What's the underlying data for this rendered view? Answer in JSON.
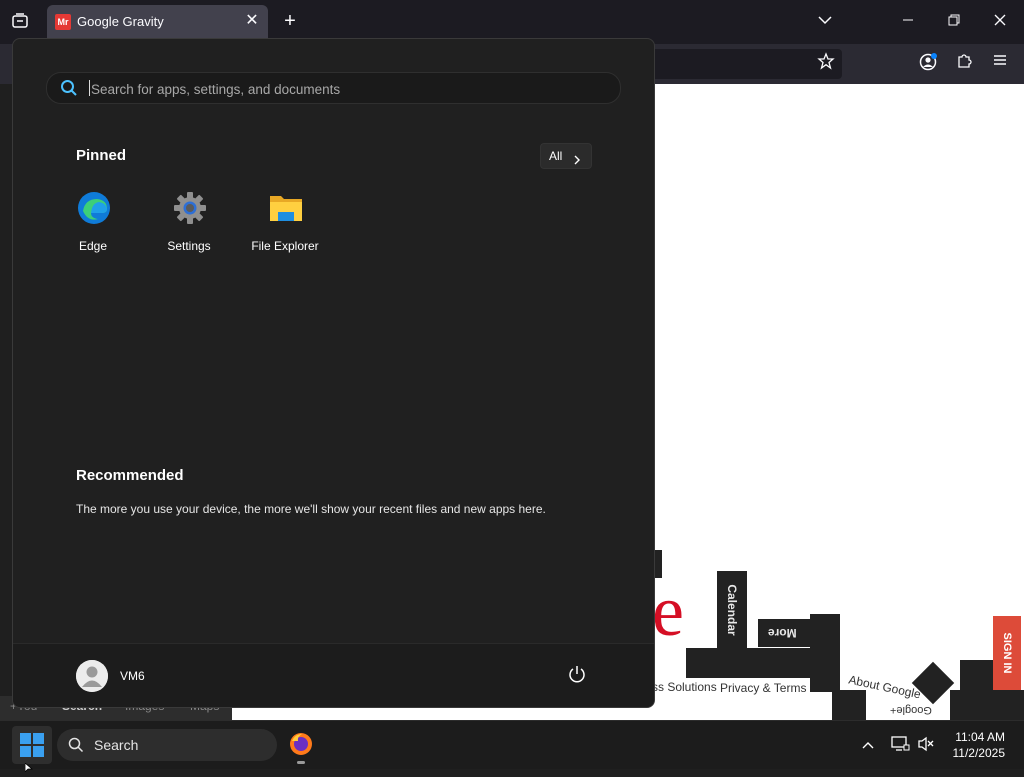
{
  "browser": {
    "tab_title": "Google Gravity",
    "tab_favicon_text": "Mr"
  },
  "page": {
    "calendar": "Calendar",
    "more": "More",
    "business": "ss Solutions",
    "privacy": "Privacy & Terms",
    "about": "About Google",
    "google_plus": "Google+",
    "sign_in": "SIGN IN",
    "logo_fragment": "e",
    "bottom_links": [
      "+You",
      "Search",
      "Images",
      "Maps"
    ]
  },
  "start_menu": {
    "search_placeholder": "Search for apps, settings, and documents",
    "pinned_title": "Pinned",
    "all_label": "All",
    "apps": [
      {
        "label": "Edge",
        "icon": "edge-icon"
      },
      {
        "label": "Settings",
        "icon": "settings-gear-icon"
      },
      {
        "label": "File Explorer",
        "icon": "folder-icon"
      }
    ],
    "recommended_title": "Recommended",
    "recommended_text": "The more you use your device, the more we'll show your recent files and new apps here.",
    "user_name": "VM6"
  },
  "taskbar": {
    "search_label": "Search",
    "time": "11:04 AM",
    "date": "11/2/2025"
  },
  "colors": {
    "accent_blue": "#0078d4",
    "signin_red": "#dd4b39"
  }
}
